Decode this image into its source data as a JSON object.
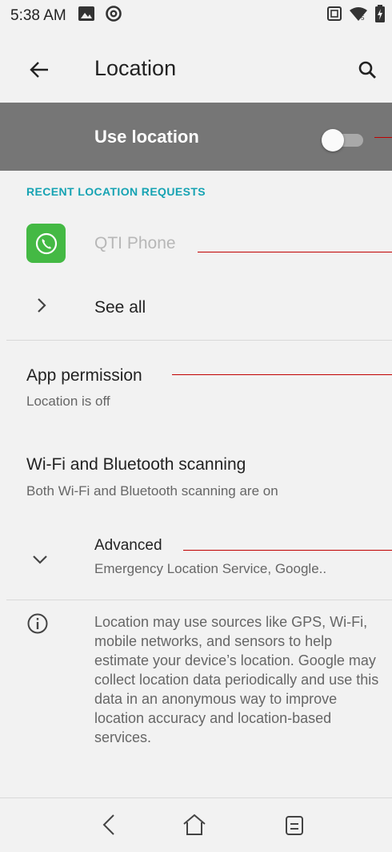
{
  "status_bar": {
    "time": "5:38 AM",
    "icons_left": [
      "image-notification-icon",
      "at-sign-notification-icon"
    ],
    "icons_right": [
      "screenshot-icon",
      "wifi-signal-icon",
      "battery-charging-icon"
    ]
  },
  "app_bar": {
    "title": "Location",
    "back_icon": "arrow-left-icon",
    "search_icon": "search-icon"
  },
  "master_switch": {
    "label": "Use location",
    "state": "off"
  },
  "recent_requests": {
    "header": "RECENT LOCATION REQUESTS",
    "apps": [
      {
        "name": "QTI Phone",
        "icon": "phone-icon"
      }
    ],
    "see_all_label": "See all"
  },
  "preferences": {
    "app_permission": {
      "title": "App permission",
      "summary": "Location is off"
    },
    "scanning": {
      "title": "Wi-Fi and Bluetooth scanning",
      "summary": "Both Wi-Fi and Bluetooth scanning are on"
    },
    "advanced": {
      "title": "Advanced",
      "summary": "Emergency Location Service, Google.."
    }
  },
  "footer_info": {
    "text": "Location may use sources like GPS, Wi-Fi, mobile networks, and sensors to help estimate your device’s location. Google may collect location data periodically and use this data in an anonymous way to improve location accuracy and location-based services."
  },
  "nav_bar": {
    "back_icon": "nav-back-icon",
    "home_icon": "nav-home-icon",
    "recents_icon": "nav-recents-icon"
  },
  "colors": {
    "background": "#f2f2f2",
    "master_bar": "#767676",
    "accent": "#16a3b3",
    "annotation_line": "#c00000",
    "app_icon": "#44b944"
  }
}
